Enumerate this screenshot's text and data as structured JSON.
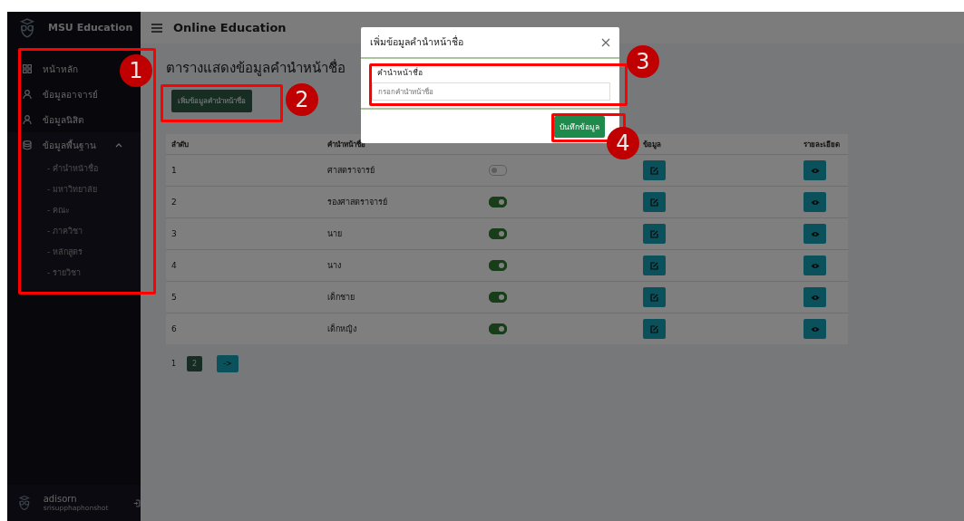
{
  "app": {
    "brand": "MSU Education",
    "title": "Online Education"
  },
  "sidebar": {
    "items": [
      {
        "label": "หน้าหลัก",
        "kind": "grid"
      },
      {
        "label": "ข้อมูลอาจารย์",
        "kind": "person"
      },
      {
        "label": "ข้อมูลนิสิต",
        "kind": "person"
      },
      {
        "label": "ข้อมูลพื้นฐาน",
        "kind": "database",
        "expanded": true,
        "children": [
          {
            "label": "- คำนำหน้าชื่อ"
          },
          {
            "label": "- มหาวิทยาลัย"
          },
          {
            "label": "- คณะ"
          },
          {
            "label": "- ภาควิชา"
          },
          {
            "label": "- หลักสูตร"
          },
          {
            "label": "- รายวิชา"
          }
        ]
      }
    ],
    "user": {
      "name": "adisorn",
      "subtitle": "srisupphaphonshot"
    }
  },
  "page": {
    "heading": "ตารางแสดงข้อมูลคำนำหน้าชื่อ",
    "add_button": "เพิ่มข้อมูลคำนำหน้าชื่อ"
  },
  "table": {
    "columns": [
      "ลำดับ",
      "คำนำหน้าชื่อ",
      "",
      "ข้อมูล",
      "รายละเอียด"
    ],
    "rows": [
      {
        "number": "1",
        "title": "ศาสตราจารย์",
        "active": false
      },
      {
        "number": "2",
        "title": "รองศาสตราจารย์",
        "active": true
      },
      {
        "number": "3",
        "title": "นาย",
        "active": true
      },
      {
        "number": "4",
        "title": "นาง",
        "active": true
      },
      {
        "number": "5",
        "title": "เด็กชาย",
        "active": true
      },
      {
        "number": "6",
        "title": "เด็กหญิง",
        "active": true
      }
    ]
  },
  "pagination": {
    "pages": [
      {
        "label": "1",
        "selected": false
      },
      {
        "label": "2",
        "selected": true
      }
    ],
    "next": "->"
  },
  "modal": {
    "title": "เพิ่มข้อมูลคำนำหน้าชื่อ",
    "field_label": "คำนำหน้าชื่อ",
    "placeholder": "กรอกคำนำหน้าชื่อ",
    "save_button": "บันทึกข้อมูล"
  },
  "annotations": [
    {
      "number": "1"
    },
    {
      "number": "2"
    },
    {
      "number": "3"
    },
    {
      "number": "4"
    }
  ]
}
